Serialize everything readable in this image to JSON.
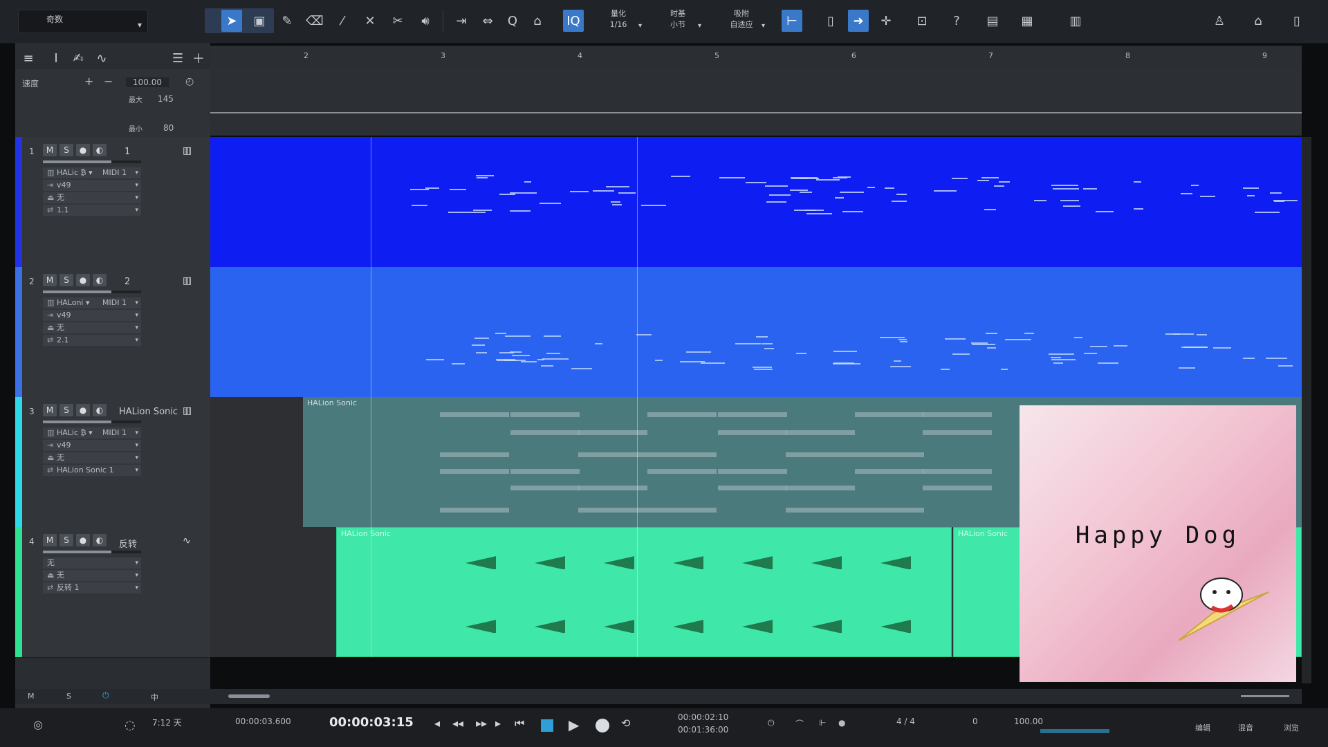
{
  "toolbar": {
    "song_title": "奇数",
    "quantize": {
      "label": "量化",
      "value": "1/16"
    },
    "timebase": {
      "label": "时基",
      "value": "小节"
    },
    "snap": {
      "label": "吸附",
      "value": "自适应"
    },
    "help_label": "?"
  },
  "left_panel": {
    "tempo": {
      "label": "速度",
      "value": "100.00",
      "max_label": "最大",
      "max_value": "145",
      "min_label": "最小",
      "min_value": "80"
    },
    "tracks": [
      {
        "num": "1",
        "name": "1",
        "color": "#2233e6",
        "inst": "HALic ₿ ▾",
        "midi": "MIDI 1",
        "input": "v49",
        "out": "无",
        "channel": "1.1"
      },
      {
        "num": "2",
        "name": "2",
        "color": "#3a6fe6",
        "inst": "HALoni ▾",
        "midi": "MIDI 1",
        "input": "v49",
        "out": "无",
        "channel": "2.1"
      },
      {
        "num": "3",
        "name": "HALion Sonic",
        "color": "#2fd8e6",
        "inst": "HALic ₿ ▾",
        "midi": "MIDI 1",
        "input": "v49",
        "out": "无",
        "channel": "HALion Sonic 1"
      },
      {
        "num": "4",
        "name": "反转",
        "color": "#2fe090",
        "inst": "无",
        "midi": "",
        "input": "无",
        "out": "反转 1",
        "channel": ""
      }
    ],
    "bottom_labels": [
      "M",
      "S",
      "中"
    ]
  },
  "ruler": {
    "marks": [
      "2",
      "3",
      "4",
      "5",
      "6",
      "7",
      "8",
      "9"
    ]
  },
  "events": {
    "track3_label": "HALion Sonic",
    "track4_label_a": "HALion Sonic",
    "track4_label_b": "HALion Sonic"
  },
  "overlay": {
    "title": "Happy Dog"
  },
  "transport": {
    "days": "7:12 天",
    "elapsed": "00:00:03.600",
    "position": "00:00:03:15",
    "loop_start": "00:00:02:10",
    "loop_end": "00:01:36:00",
    "meter": "4 / 4",
    "key": "0",
    "tempo": "100.00",
    "tab_edit": "编辑",
    "tab_mix": "混音",
    "tab_browse": "浏览"
  }
}
